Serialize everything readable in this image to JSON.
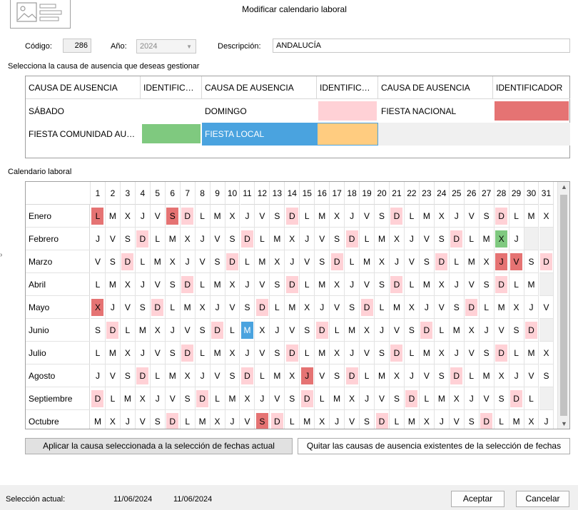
{
  "window": {
    "title": "Modificar calendario laboral"
  },
  "form": {
    "codigo_label": "Código:",
    "codigo_value": "286",
    "anio_label": "Año:",
    "anio_value": "2024",
    "descripcion_label": "Descripción:",
    "descripcion_value": "ANDALUCÍA"
  },
  "causes_section": {
    "title": "Selecciona la causa de ausencia que deseas gestionar",
    "headers": [
      "CAUSA DE AUSENCIA",
      "IDENTIFICADOR",
      "CAUSA DE AUSENCIA",
      "IDENTIFICADOR",
      "CAUSA DE AUSENCIA",
      "IDENTIFICADOR"
    ],
    "rows": [
      [
        {
          "name": "SÁBADO",
          "color": ""
        },
        {
          "name": "DOMINGO",
          "color": "#ffd1d6"
        },
        {
          "name": "FIESTA NACIONAL",
          "color": "#e57373"
        }
      ],
      [
        {
          "name": "FIESTA COMUNIDAD AUTÓNOMA",
          "color": "#7fc97f"
        },
        {
          "name": "FIESTA LOCAL",
          "color": "#ffcc80",
          "selected": true
        }
      ]
    ],
    "selected_color": "#4aa3df"
  },
  "calendar": {
    "title": "Calendario laboral",
    "days": [
      "1",
      "2",
      "3",
      "4",
      "5",
      "6",
      "7",
      "8",
      "9",
      "10",
      "11",
      "12",
      "13",
      "14",
      "15",
      "16",
      "17",
      "18",
      "19",
      "20",
      "21",
      "22",
      "23",
      "24",
      "25",
      "26",
      "27",
      "28",
      "29",
      "30",
      "31"
    ],
    "colors": {
      "S": "#ffd1d6",
      "N": "#e57373",
      "C": "#7fc97f",
      "SEL": "#4aa3df"
    },
    "months": [
      {
        "name": "Enero",
        "letters": "LMXJVSDLMXJVSDLMXJVSDLMXJVSDLMX",
        "marks": {
          "1": "N",
          "6": "N",
          "7": "S",
          "14": "S",
          "21": "S",
          "28": "S"
        }
      },
      {
        "name": "Febrero",
        "letters": "JVSDLMXJVSDLMXJVSDLMXJVSDLMXJ",
        "marks": {
          "4": "S",
          "11": "S",
          "18": "S",
          "25": "S",
          "28": "C"
        }
      },
      {
        "name": "Marzo",
        "letters": "VSDLMXJVSDLMXJVSDLMXJVSDLMXJVSD",
        "marks": {
          "3": "S",
          "10": "S",
          "17": "S",
          "24": "S",
          "28": "N",
          "29": "N",
          "31": "S"
        }
      },
      {
        "name": "Abril",
        "letters": "LMXJVSDLMXJVSDLMXJVSDLMXJVSDLM",
        "marks": {
          "7": "S",
          "14": "S",
          "21": "S",
          "28": "S"
        }
      },
      {
        "name": "Mayo",
        "letters": "XJVSDLMXJVSDLMXJVSDLMXJVSDLMXJV",
        "marks": {
          "1": "N",
          "5": "S",
          "12": "S",
          "19": "S",
          "26": "S"
        }
      },
      {
        "name": "Junio",
        "letters": "SDLMXJVSDLMXJVSDLMXJVSDLMXJVSD",
        "marks": {
          "2": "S",
          "9": "S",
          "11": "SEL",
          "16": "S",
          "23": "S",
          "30": "S"
        }
      },
      {
        "name": "Julio",
        "letters": "LMXJVSDLMXJVSDLMXJVSDLMXJVSDLMX",
        "marks": {
          "7": "S",
          "14": "S",
          "21": "S",
          "28": "S"
        }
      },
      {
        "name": "Agosto",
        "letters": "JVSDLMXJVSDLMXJVSDLMXJVSDLMXJVS",
        "marks": {
          "4": "S",
          "11": "S",
          "15": "N",
          "18": "S",
          "25": "S"
        }
      },
      {
        "name": "Septiembre",
        "letters": "DLMXJVSDLMXJVSDLMXJVSDLMXJVSDL",
        "marks": {
          "1": "S",
          "8": "S",
          "15": "S",
          "22": "S",
          "29": "S"
        }
      },
      {
        "name": "Octubre",
        "letters": "MXJVSDLMXJVSDLMXJVSDLMXJVSDLMXJ",
        "marks": {
          "6": "S",
          "12": "N",
          "13": "S",
          "20": "S",
          "27": "S"
        }
      }
    ]
  },
  "actions": {
    "apply_label": "Aplicar la causa seleccionada a la selección de fechas actual",
    "remove_label": "Quitar las causas de ausencia existentes de la selección de fechas"
  },
  "footer": {
    "selection_label": "Selección actual:",
    "from_date": "11/06/2024",
    "to_date": "11/06/2024",
    "accept_label": "Aceptar",
    "cancel_label": "Cancelar"
  }
}
